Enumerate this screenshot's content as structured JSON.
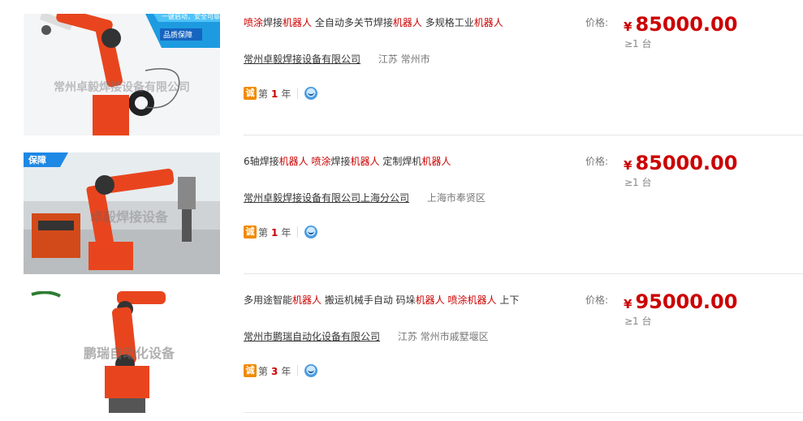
{
  "listings": [
    {
      "title_segments": [
        {
          "text": "喷涂",
          "kw": true
        },
        {
          "text": "焊接",
          "kw": false
        },
        {
          "text": "机器人",
          "kw": true
        },
        {
          "text": " 全自动多关节焊接",
          "kw": false
        },
        {
          "text": "机器人",
          "kw": true
        },
        {
          "text": " 多规格工业",
          "kw": false
        },
        {
          "text": "机器人",
          "kw": true
        }
      ],
      "company": "常州卓毅焊接设备有限公司",
      "location": "江苏 常州市",
      "cheng_badge": "诚",
      "year_prefix": "第",
      "year": "1",
      "year_suffix": "年",
      "price_label": "价格:",
      "currency": "¥",
      "price": "85000.00",
      "moq": "≥1 台",
      "image_text": "常州卓毅焊接设备有限公司",
      "image_banner": [
        "一键启动，安全可靠",
        "品质保障"
      ]
    },
    {
      "title_segments": [
        {
          "text": "6轴焊接",
          "kw": false
        },
        {
          "text": "机器人",
          "kw": true
        },
        {
          "text": " ",
          "kw": false
        },
        {
          "text": "喷涂",
          "kw": true
        },
        {
          "text": "焊接",
          "kw": false
        },
        {
          "text": "机器人",
          "kw": true
        },
        {
          "text": " 定制焊机",
          "kw": false
        },
        {
          "text": "机器人",
          "kw": true
        }
      ],
      "company": "常州卓毅焊接设备有限公司上海分公司",
      "location": "上海市奉贤区",
      "cheng_badge": "诚",
      "year_prefix": "第",
      "year": "1",
      "year_suffix": "年",
      "price_label": "价格:",
      "currency": "¥",
      "price": "85000.00",
      "moq": "≥1 台",
      "image_text": "卓毅焊接设备",
      "image_banner": [
        "保障"
      ]
    },
    {
      "title_segments": [
        {
          "text": "多用途智能",
          "kw": false
        },
        {
          "text": "机器人",
          "kw": true
        },
        {
          "text": " 搬运机械手自动 码垛",
          "kw": false
        },
        {
          "text": "机器人",
          "kw": true
        },
        {
          "text": " ",
          "kw": false
        },
        {
          "text": "喷涂",
          "kw": true
        },
        {
          "text": "机器人",
          "kw": true
        },
        {
          "text": " 上下",
          "kw": false
        }
      ],
      "company": "常州市鹏瑞自动化设备有限公司",
      "location": "江苏 常州市戚墅堰区",
      "cheng_badge": "诚",
      "year_prefix": "第",
      "year": "3",
      "year_suffix": "年",
      "price_label": "价格:",
      "currency": "¥",
      "price": "95000.00",
      "moq": "≥1 台",
      "image_text": "鹏瑞自动化设备",
      "image_banner": []
    }
  ],
  "colors": {
    "keyword": "#cc0000",
    "price": "#cc0000",
    "robot": "#e8451e",
    "cheng": "#f08a00"
  }
}
